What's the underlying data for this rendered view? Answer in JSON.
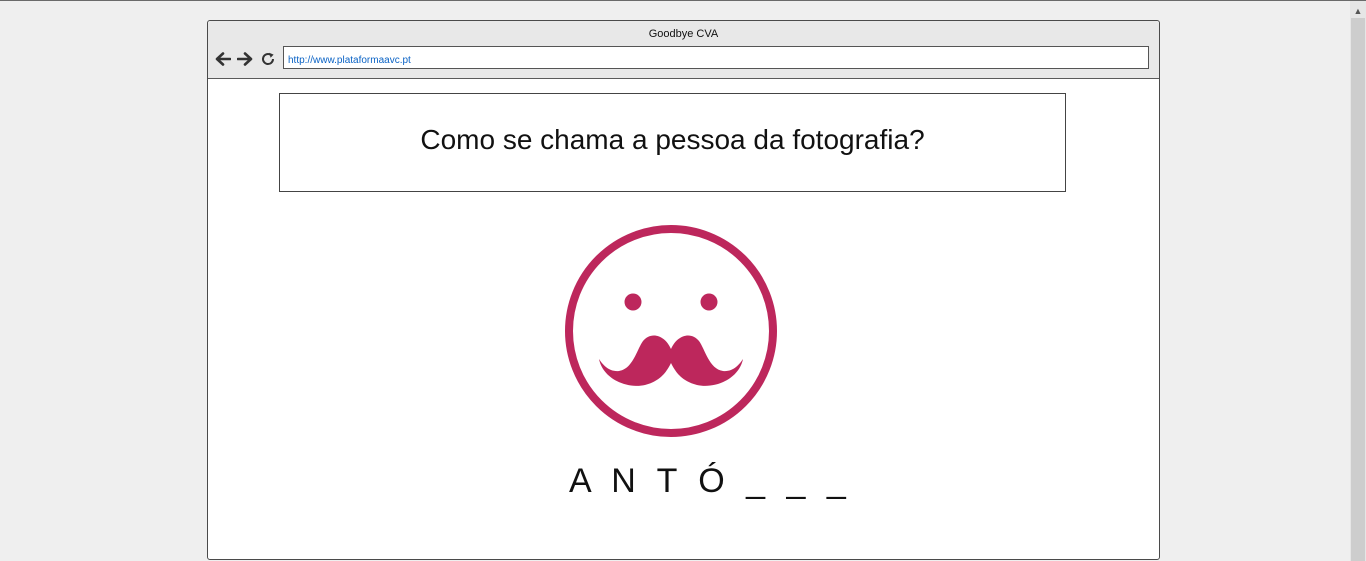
{
  "window": {
    "title": "Goodbye CVA"
  },
  "toolbar": {
    "back_icon": "arrow-left-icon",
    "forward_icon": "arrow-right-icon",
    "reload_icon": "reload-icon",
    "url": "http://www.plataformaavc.pt"
  },
  "content": {
    "question": "Como se chama a pessoa da fotografia?",
    "image_icon": "mustache-face-icon",
    "image_color": "#bd275c",
    "answer_hint": "A N T Ó _ _ _"
  },
  "scrollbar": {
    "up_icon": "scroll-up-icon"
  }
}
